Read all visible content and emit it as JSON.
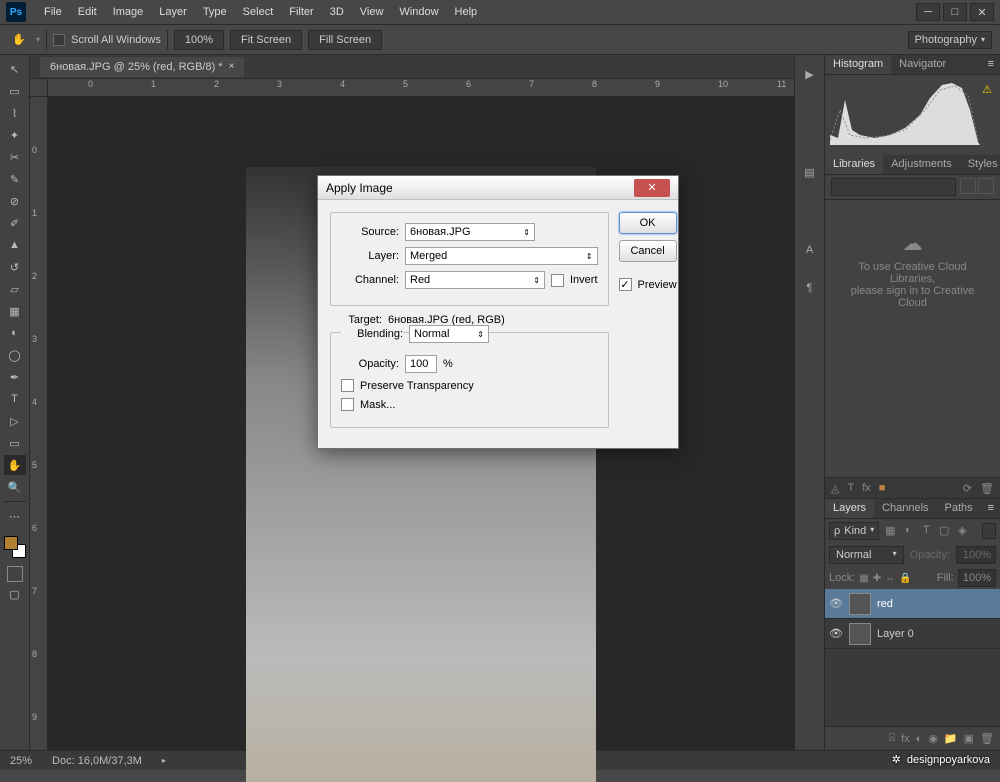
{
  "titlebar": {
    "logo": "Ps",
    "menus": [
      "File",
      "Edit",
      "Image",
      "Layer",
      "Type",
      "Select",
      "Filter",
      "3D",
      "View",
      "Window",
      "Help"
    ]
  },
  "optionsbar": {
    "scroll_all": "Scroll All Windows",
    "zoom": "100%",
    "fit": "Fit Screen",
    "fill": "Fill Screen",
    "workspace": "Photography"
  },
  "doc": {
    "tab_label": "6новая.JPG @ 25% (red, RGB/8) *"
  },
  "ruler_h": [
    "0",
    "1",
    "2",
    "3",
    "4",
    "5",
    "6",
    "7",
    "8",
    "9",
    "10",
    "11"
  ],
  "ruler_v": [
    "0",
    "1",
    "2",
    "3",
    "4",
    "5",
    "6",
    "7",
    "8",
    "9"
  ],
  "panels": {
    "histogram_tabs": [
      "Histogram",
      "Navigator"
    ],
    "libraries_tabs": [
      "Libraries",
      "Adjustments",
      "Styles"
    ],
    "cc_note1": "To use Creative Cloud Libraries,",
    "cc_note2": "please sign in to Creative Cloud",
    "layers_tabs": [
      "Layers",
      "Channels",
      "Paths"
    ],
    "kind_label": "Kind",
    "blend": "Normal",
    "opacity_label": "Opacity:",
    "opacity_value": "100%",
    "lock_label": "Lock:",
    "fill_label": "Fill:",
    "fill_value": "100%",
    "layer1": "red",
    "layer2": "Layer 0"
  },
  "status": {
    "zoom": "25%",
    "doc": "Doc: 16,0M/37,3M"
  },
  "dialog": {
    "title": "Apply Image",
    "source_lbl": "Source:",
    "source_val": "6новая.JPG",
    "layer_lbl": "Layer:",
    "layer_val": "Merged",
    "channel_lbl": "Channel:",
    "channel_val": "Red",
    "invert_lbl": "Invert",
    "target_lbl": "Target:",
    "target_val": "6новая.JPG (red, RGB)",
    "blending_lbl": "Blending:",
    "blending_val": "Normal",
    "opacity_lbl": "Opacity:",
    "opacity_val": "100",
    "opacity_pct": "%",
    "preserve": "Preserve Transparency",
    "mask": "Mask...",
    "ok": "OK",
    "cancel": "Cancel",
    "preview": "Preview"
  },
  "watermark": "designpoyarkova"
}
